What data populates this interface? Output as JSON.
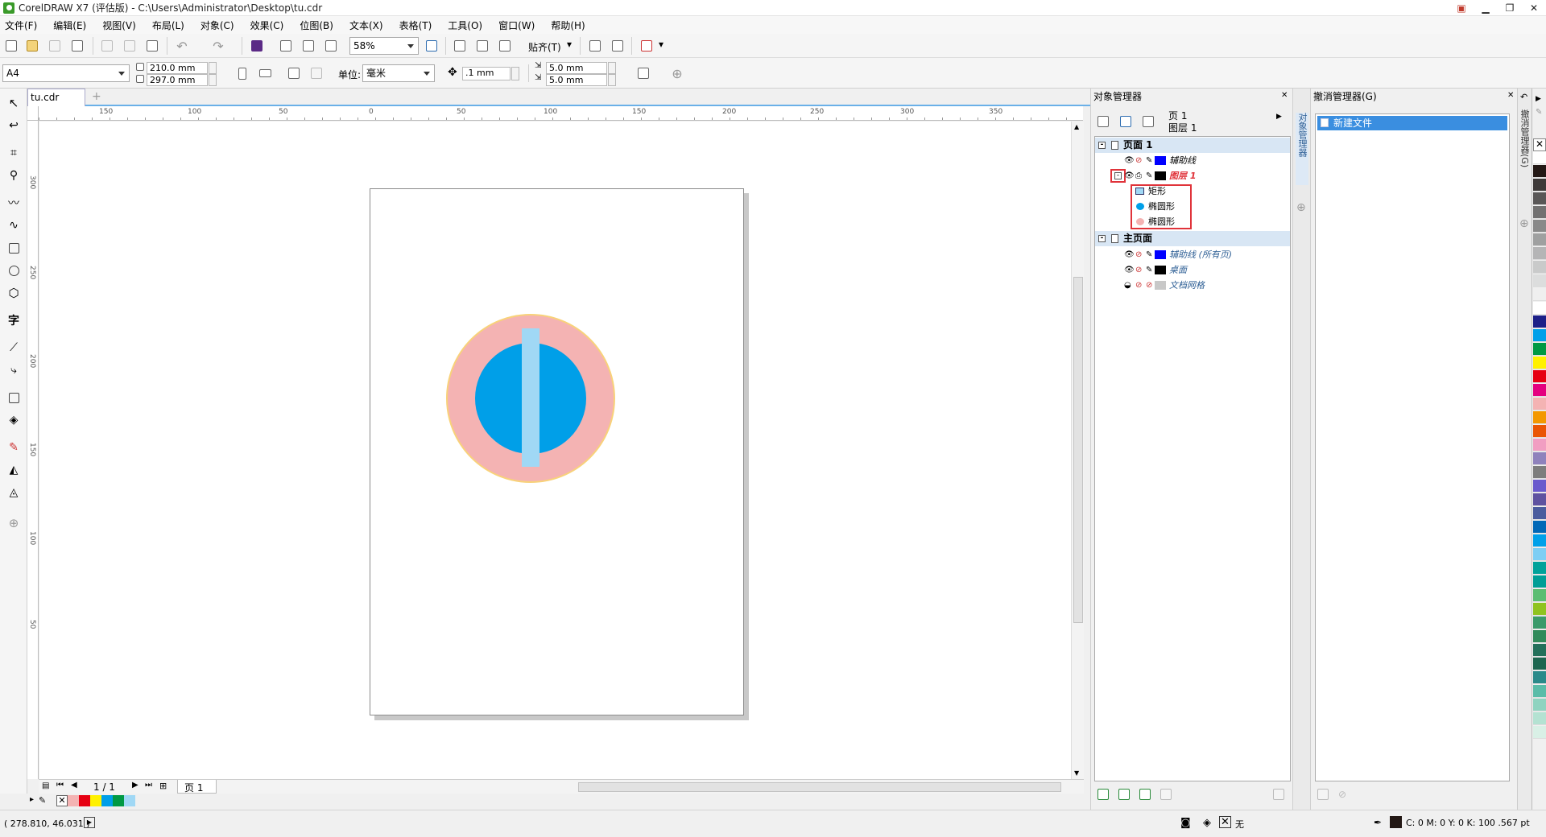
{
  "window": {
    "title": "CorelDRAW X7 (评估版) - C:\\Users\\Administrator\\Desktop\\tu.cdr",
    "minimize": "▁",
    "maximize": "❐",
    "close": "✕"
  },
  "menu": [
    "文件(F)",
    "编辑(E)",
    "视图(V)",
    "布局(L)",
    "对象(C)",
    "效果(C)",
    "位图(B)",
    "文本(X)",
    "表格(T)",
    "工具(O)",
    "窗口(W)",
    "帮助(H)"
  ],
  "toolbar": {
    "zoom": "58%",
    "snap_label": "贴齐(T)"
  },
  "propertybar": {
    "page_size": "A4",
    "width": "210.0 mm",
    "height": "297.0 mm",
    "unit_label": "单位:",
    "unit": "毫米",
    "nudge": ".1 mm",
    "dup_x": "5.0 mm",
    "dup_y": "5.0 mm"
  },
  "document": {
    "tab": "tu.cdr",
    "page_indicator": "1 / 1",
    "page_tab": "页 1"
  },
  "ruler": {
    "h_ticks": [
      "150",
      "100",
      "50",
      "0",
      "50",
      "100",
      "150",
      "200",
      "250",
      "300",
      "350"
    ],
    "v_ticks": [
      "300",
      "250",
      "200",
      "150",
      "100",
      "50"
    ]
  },
  "doc_palette": [
    "#f4b3b3",
    "#e60012",
    "#fff100",
    "#009fe8",
    "#009944",
    "#a0d8f5"
  ],
  "object_manager": {
    "title": "对象管理器",
    "page_label": "页 1",
    "layer_label": "图层 1",
    "tree": [
      {
        "label": "页面 1",
        "type": "page"
      },
      {
        "label": "辅助线",
        "type": "layer",
        "color": "#0000ff"
      },
      {
        "label": "图层 1",
        "type": "layer-active",
        "color": "#000000"
      },
      {
        "label": "矩形",
        "type": "object",
        "icon": "rectangle-icon"
      },
      {
        "label": "椭圆形",
        "type": "object",
        "icon": "ellipse-icon",
        "color": "#009fe8"
      },
      {
        "label": "椭圆形",
        "type": "object",
        "icon": "ellipse-icon",
        "color": "#f4b3b3"
      },
      {
        "label": "主页面",
        "type": "page"
      },
      {
        "label": "辅助线 (所有页)",
        "type": "master-layer",
        "color": "#0000ff"
      },
      {
        "label": "桌面",
        "type": "master-layer",
        "color": "#000000"
      },
      {
        "label": "文档网格",
        "type": "master-layer",
        "color": "#c8c8c8"
      }
    ]
  },
  "docker_tab": "对象管理器",
  "undo_manager": {
    "title": "撤消管理器(G)",
    "items": [
      "新建文件"
    ],
    "vertical_tab": "撤消管理器(G)"
  },
  "status": {
    "coords": "( 278.810, 46.031 )",
    "fill_label": "无",
    "outline_info": "C: 0 M: 0 Y: 0 K: 100  .567 pt"
  },
  "artwork": {
    "outer_circle_color": "#f4b3b3",
    "outer_circle_stroke": "#f8d27a",
    "inner_circle_color": "#009fe8",
    "bar_color": "#a0d8f5"
  },
  "color_palette": [
    "#ffffff",
    "#231815",
    "#3e3a39",
    "#595757",
    "#727171",
    "#898989",
    "#9fa0a0",
    "#b5b5b6",
    "#c9caca",
    "#dcdddd",
    "#efefef",
    "#ffffff",
    "#1d2088",
    "#00a0e9",
    "#009944",
    "#fff100",
    "#e60012",
    "#e4007f",
    "#f4b3b3",
    "#f39800",
    "#ea5504",
    "#f19ec2",
    "#8f82bc",
    "#7d7d7d",
    "#6a5acd",
    "#5f52a0",
    "#4b5c9e",
    "#0068b7",
    "#00a0e9",
    "#7ecef4",
    "#00a29a",
    "#009e96",
    "#5bbd72",
    "#8fc31f",
    "#3a9a6a",
    "#318a5a",
    "#23705a",
    "#1e6650",
    "#2a8a8a",
    "#5abca8",
    "#8fd3c0",
    "#b4e2d2",
    "#d9f0e6"
  ]
}
